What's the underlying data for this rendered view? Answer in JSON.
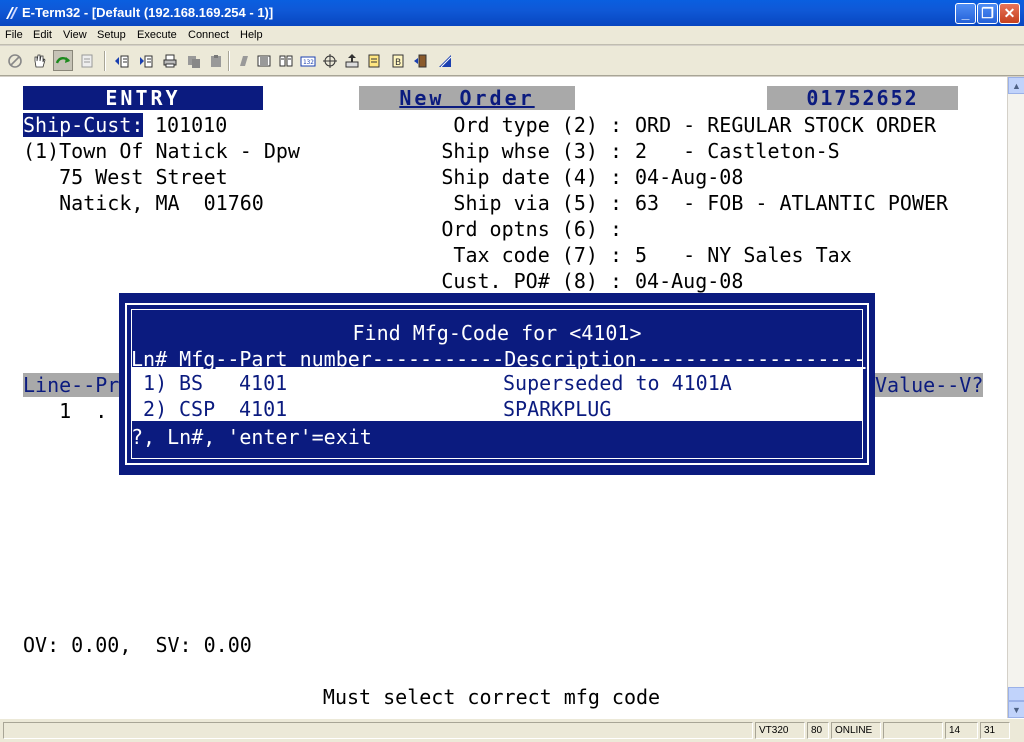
{
  "window": {
    "title": "E-Term32 - [Default (192.168.169.254 - 1)]",
    "minimize": "_",
    "restore": "❐",
    "close": "✕"
  },
  "menu": [
    "File",
    "Edit",
    "View",
    "Setup",
    "Execute",
    "Connect",
    "Help"
  ],
  "toolbar_icons": [
    "disconnect-icon",
    "hand-icon",
    "connect-icon",
    "print-screen-icon",
    "send-file-icon",
    "receive-file-icon",
    "printer-icon",
    "copy-icon",
    "paste-icon",
    "clear-icon",
    "capture-icon",
    "log-icon",
    "keyboard-icon",
    "mouse-icon",
    "ftp-icon",
    "script-icon",
    "macro-icon",
    "exit-door-icon",
    "settings-icon"
  ],
  "header": {
    "entry": "ENTRY",
    "mode": "New Order",
    "order_number": "01752652"
  },
  "customer": {
    "label": "Ship-Cust:",
    "code": "101010",
    "name": "(1)Town Of Natick - Dpw",
    "street": "   75 West Street",
    "city": "   Natick, MA  01760"
  },
  "order_fields": [
    {
      "label": "Ord type (2) :",
      "value": "ORD - REGULAR STOCK ORDER"
    },
    {
      "label": "Ship whse (3) :",
      "value": "2   - Castleton-S"
    },
    {
      "label": "Ship date (4) :",
      "value": "04-Aug-08"
    },
    {
      "label": "Ship via (5) :",
      "value": "63  - FOB - ATLANTIC POWER"
    },
    {
      "label": "Ord optns (6) :",
      "value": ""
    },
    {
      "label": "Tax code (7) :",
      "value": "5   - NY Sales Tax"
    },
    {
      "label": "Cust. PO# (8) :",
      "value": "04-Aug-08"
    }
  ],
  "lines": {
    "header_left": "Line--Pr",
    "header_right": "Value--V?",
    "row1": "  1  ."
  },
  "popup": {
    "title": "Find Mfg-Code for <4101>",
    "columns": "Ln# Mfg--Part_number-----------Description-------------------",
    "rows": [
      {
        "ln": " 1)",
        "mfg": "BS",
        "part": "4101",
        "description": "Superseded to 4101A"
      },
      {
        "ln": " 2)",
        "mfg": "CSP",
        "part": "4101",
        "description": "SPARKPLUG"
      }
    ],
    "prompt": "?, Ln#, 'enter'=exit"
  },
  "totals": "OV: 0.00,  SV: 0.00",
  "message": "Must select correct mfg code",
  "status": {
    "emulation": "VT320",
    "columns": "80",
    "connection": "ONLINE",
    "row": "14",
    "col": "31"
  },
  "colors": {
    "terminal_blue": "#0b1b7f",
    "titlebar_blue": "#0a5fe0",
    "highlight_gray": "#a9a9a9"
  }
}
